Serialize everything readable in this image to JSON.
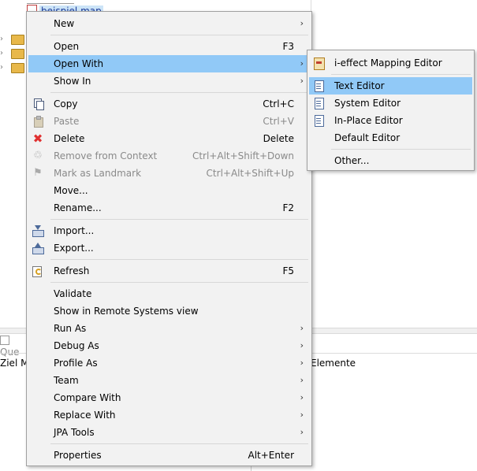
{
  "background": {
    "selected_file": "beispiel.map",
    "view_tab_label": "Que",
    "left_column_label": "Ziel Mo",
    "right_column_label": "Elemente"
  },
  "context_menu": {
    "items": [
      {
        "label": "New",
        "shortcut": "",
        "submenu": true,
        "icon": "",
        "disabled": false
      },
      {
        "label": "Open",
        "shortcut": "F3",
        "submenu": false,
        "icon": "",
        "disabled": false
      },
      {
        "label": "Open With",
        "shortcut": "",
        "submenu": true,
        "icon": "",
        "disabled": false,
        "highlighted": true
      },
      {
        "label": "Show In",
        "shortcut": "",
        "submenu": true,
        "icon": "",
        "disabled": false
      },
      {
        "label": "Copy",
        "shortcut": "Ctrl+C",
        "submenu": false,
        "icon": "copy-icon",
        "disabled": false
      },
      {
        "label": "Paste",
        "shortcut": "Ctrl+V",
        "submenu": false,
        "icon": "paste-icon",
        "disabled": true
      },
      {
        "label": "Delete",
        "shortcut": "Delete",
        "submenu": false,
        "icon": "delete-icon",
        "disabled": false
      },
      {
        "label": "Remove from Context",
        "shortcut": "Ctrl+Alt+Shift+Down",
        "submenu": false,
        "icon": "remove-context-icon",
        "disabled": true
      },
      {
        "label": "Mark as Landmark",
        "shortcut": "Ctrl+Alt+Shift+Up",
        "submenu": false,
        "icon": "landmark-icon",
        "disabled": true
      },
      {
        "label": "Move...",
        "shortcut": "",
        "submenu": false,
        "icon": "",
        "disabled": false
      },
      {
        "label": "Rename...",
        "shortcut": "F2",
        "submenu": false,
        "icon": "",
        "disabled": false
      },
      {
        "label": "Import...",
        "shortcut": "",
        "submenu": false,
        "icon": "import-icon",
        "disabled": false
      },
      {
        "label": "Export...",
        "shortcut": "",
        "submenu": false,
        "icon": "export-icon",
        "disabled": false
      },
      {
        "label": "Refresh",
        "shortcut": "F5",
        "submenu": false,
        "icon": "refresh-icon",
        "disabled": false
      },
      {
        "label": "Validate",
        "shortcut": "",
        "submenu": false,
        "icon": "",
        "disabled": false
      },
      {
        "label": "Show in Remote Systems view",
        "shortcut": "",
        "submenu": false,
        "icon": "",
        "disabled": false
      },
      {
        "label": "Run As",
        "shortcut": "",
        "submenu": true,
        "icon": "",
        "disabled": false
      },
      {
        "label": "Debug As",
        "shortcut": "",
        "submenu": true,
        "icon": "",
        "disabled": false
      },
      {
        "label": "Profile As",
        "shortcut": "",
        "submenu": true,
        "icon": "",
        "disabled": false
      },
      {
        "label": "Team",
        "shortcut": "",
        "submenu": true,
        "icon": "",
        "disabled": false
      },
      {
        "label": "Compare With",
        "shortcut": "",
        "submenu": true,
        "icon": "",
        "disabled": false
      },
      {
        "label": "Replace With",
        "shortcut": "",
        "submenu": true,
        "icon": "",
        "disabled": false
      },
      {
        "label": "JPA Tools",
        "shortcut": "",
        "submenu": true,
        "icon": "",
        "disabled": false
      },
      {
        "label": "Properties",
        "shortcut": "Alt+Enter",
        "submenu": false,
        "icon": "",
        "disabled": false
      }
    ]
  },
  "open_with_submenu": {
    "items": [
      {
        "label": "i-effect Mapping Editor",
        "icon": "mapping-editor-icon",
        "highlighted": false
      },
      {
        "label": "Text Editor",
        "icon": "text-editor-icon",
        "highlighted": true
      },
      {
        "label": "System Editor",
        "icon": "system-editor-icon",
        "highlighted": false
      },
      {
        "label": "In-Place Editor",
        "icon": "in-place-editor-icon",
        "highlighted": false
      },
      {
        "label": "Default Editor",
        "icon": "",
        "highlighted": false
      },
      {
        "label": "Other...",
        "icon": "",
        "highlighted": false
      }
    ]
  },
  "colors": {
    "menu_background": "#f2f2f2",
    "highlight": "#91c9f7",
    "disabled_text": "#8a8a8a",
    "delete_icon": "#e03030"
  }
}
